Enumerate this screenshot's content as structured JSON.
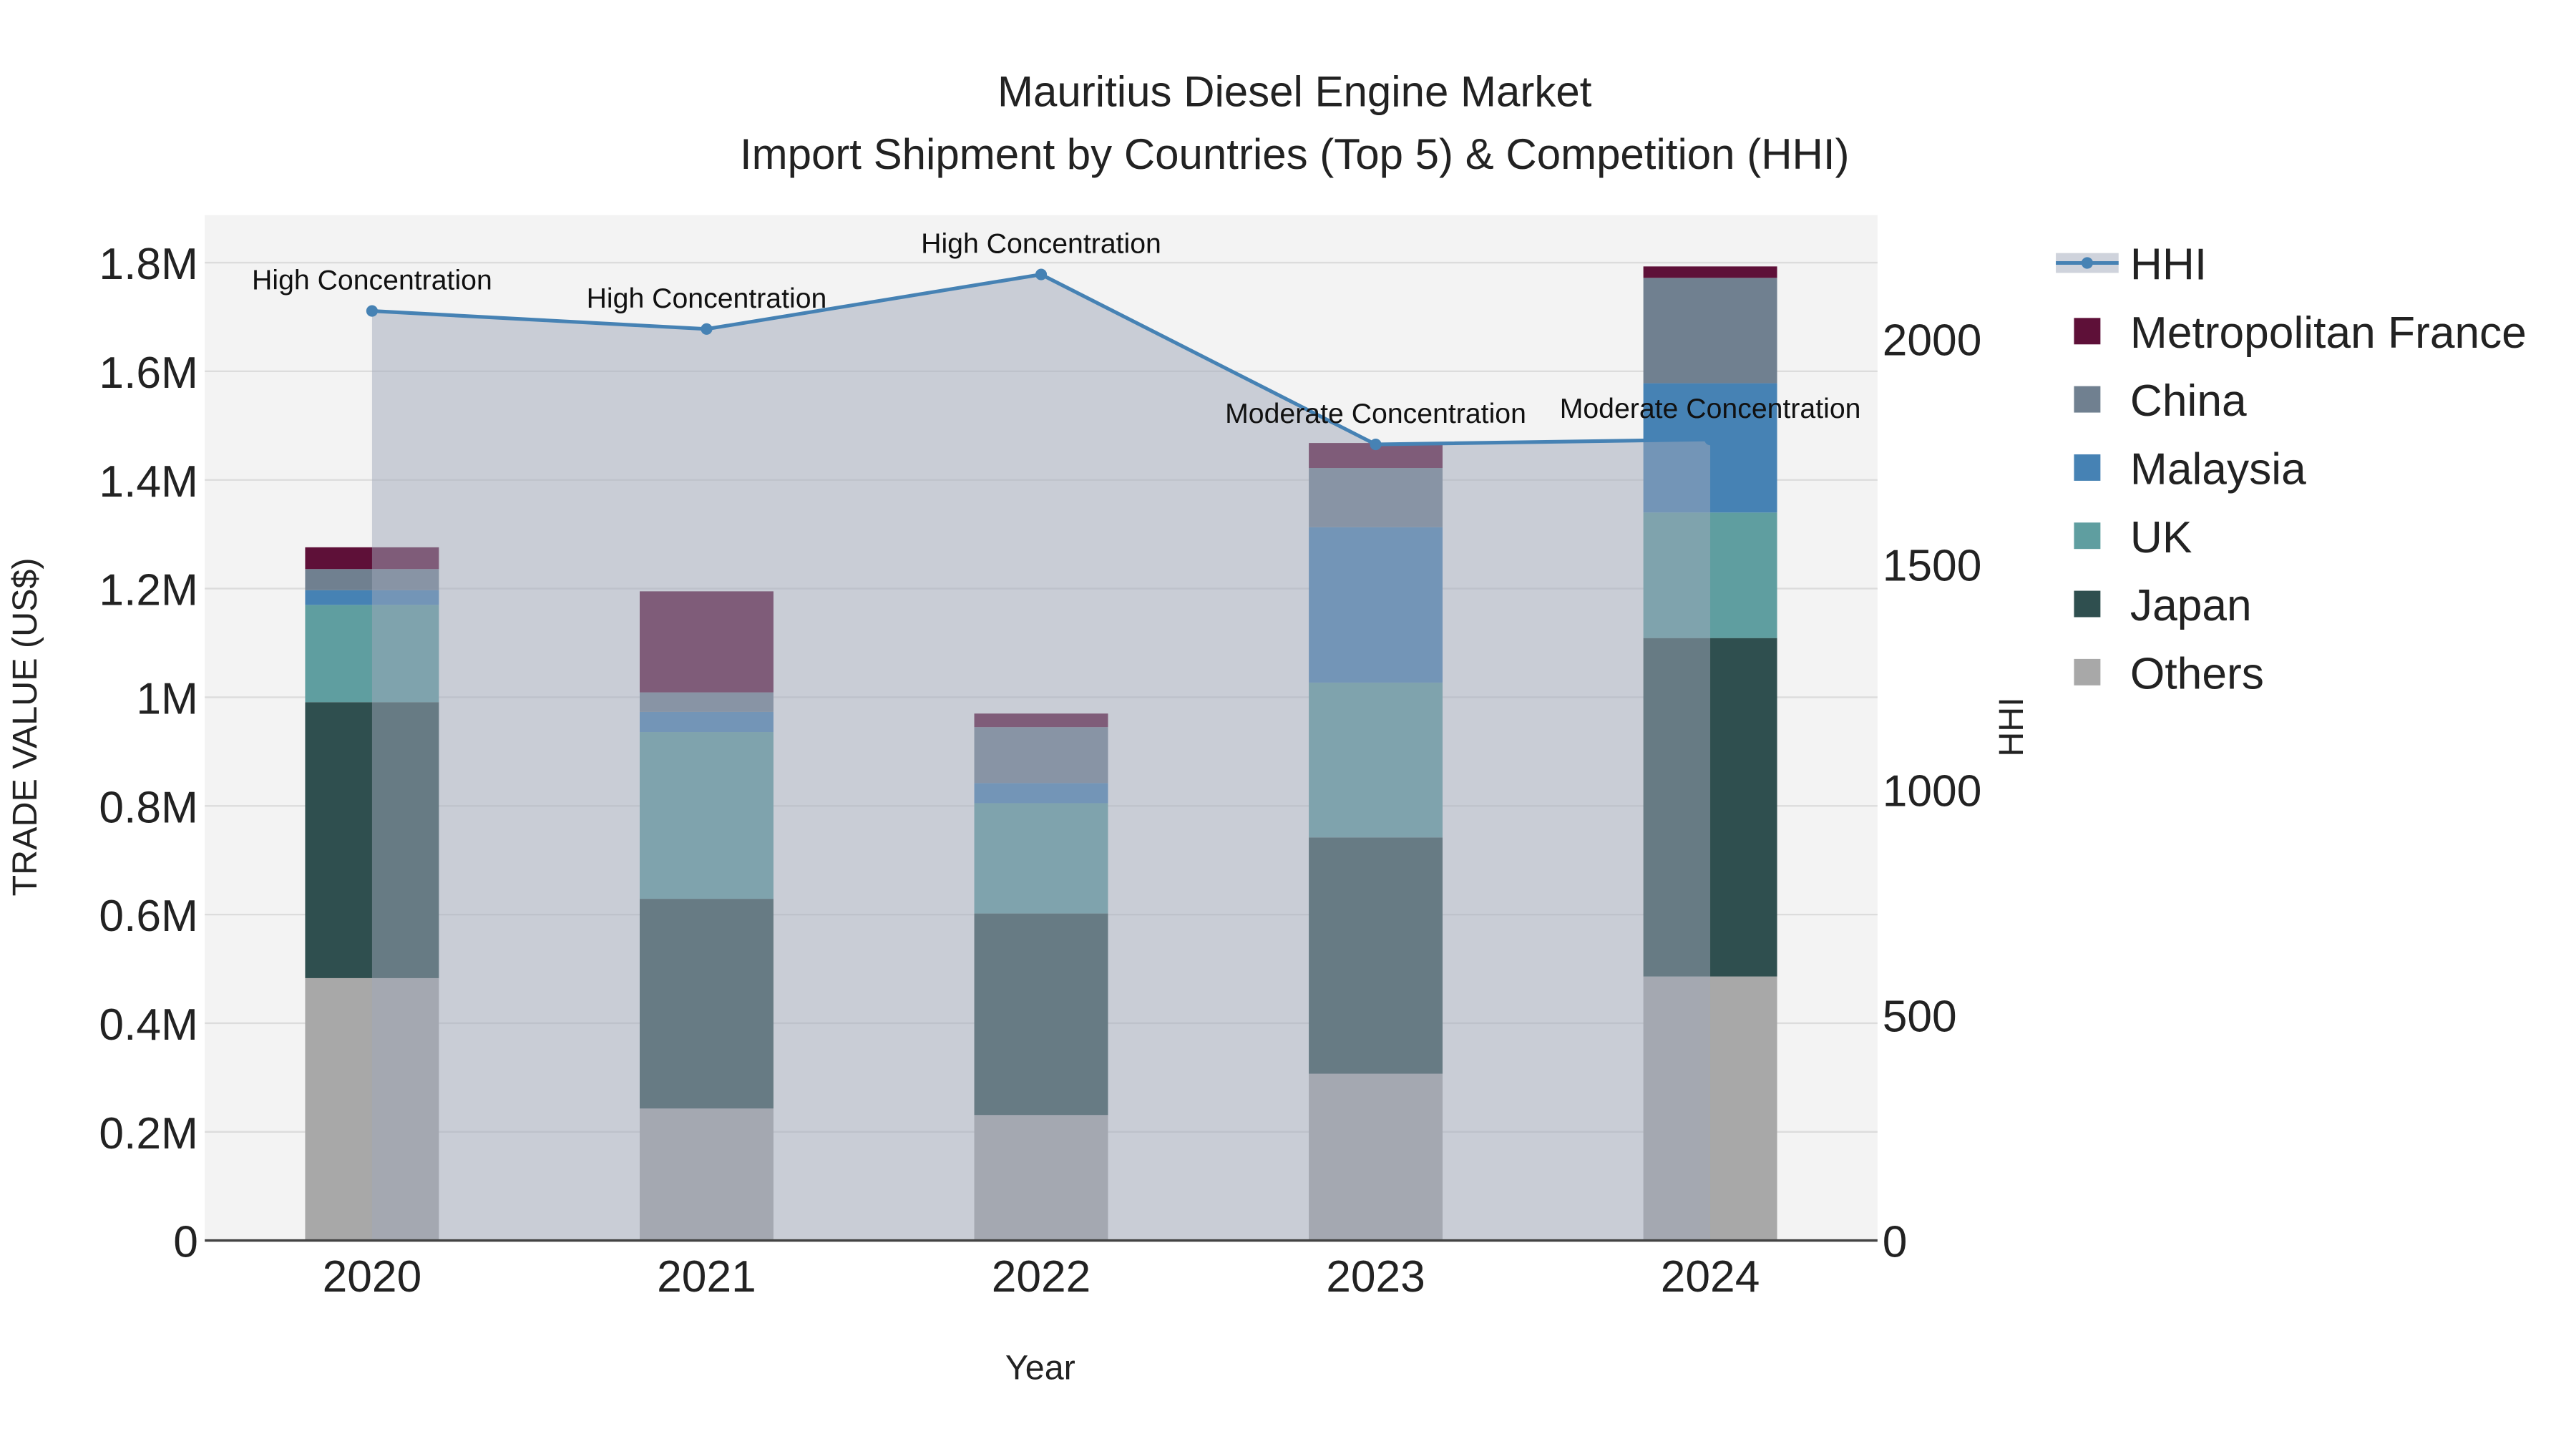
{
  "chart_data": {
    "type": "bar",
    "stacked": true,
    "title": "Mauritius Diesel Engine Market",
    "subtitle": "Import Shipment by Countries (Top 5) & Competition (HHI)",
    "xlabel": "Year",
    "ylabel": "TRADE VALUE (US$)",
    "y2label": "HHI",
    "categories": [
      "2020",
      "2021",
      "2022",
      "2023",
      "2024"
    ],
    "ylim": [
      0,
      1900000
    ],
    "y_ticks": [
      0,
      200000,
      400000,
      600000,
      800000,
      1000000,
      1200000,
      1400000,
      1600000,
      1800000
    ],
    "y_tick_labels": [
      "0",
      "0.2M",
      "0.4M",
      "0.6M",
      "0.8M",
      "1M",
      "1.2M",
      "1.4M",
      "1.6M",
      "1.8M"
    ],
    "y2lim": [
      0,
      2274
    ],
    "y2_ticks": [
      0,
      500,
      1000,
      1500,
      2000
    ],
    "y2_tick_labels": [
      "0",
      "500",
      "1000",
      "1500",
      "2000"
    ],
    "series": [
      {
        "name": "Others",
        "color": "#a8a8a8",
        "values": [
          483000,
          243000,
          231000,
          307000,
          486000
        ]
      },
      {
        "name": "Japan",
        "color": "#2f4f4f",
        "values": [
          508000,
          386000,
          371000,
          435000,
          623000
        ]
      },
      {
        "name": "UK",
        "color": "#5f9ea0",
        "values": [
          179000,
          307000,
          203000,
          285000,
          231000
        ]
      },
      {
        "name": "Malaysia",
        "color": "#4682b4",
        "values": [
          27000,
          37000,
          37000,
          286000,
          238000
        ]
      },
      {
        "name": "China",
        "color": "#708090",
        "values": [
          39000,
          36000,
          103000,
          109000,
          194000
        ]
      },
      {
        "name": "Metropolitan France",
        "color": "#5e1038",
        "values": [
          40000,
          186000,
          25000,
          46000,
          21000
        ]
      }
    ],
    "line": {
      "name": "HHI",
      "color": "#4682b4",
      "values": [
        2062,
        2022,
        2143,
        1766,
        1777
      ],
      "annotations": [
        "High Concentration",
        "High Concentration",
        "High Concentration",
        "Moderate Concentration",
        "Moderate Concentration"
      ]
    },
    "legend_order": [
      "HHI",
      "Metropolitan France",
      "China",
      "Malaysia",
      "UK",
      "Japan",
      "Others"
    ],
    "legend_position": "right",
    "grid": true
  }
}
